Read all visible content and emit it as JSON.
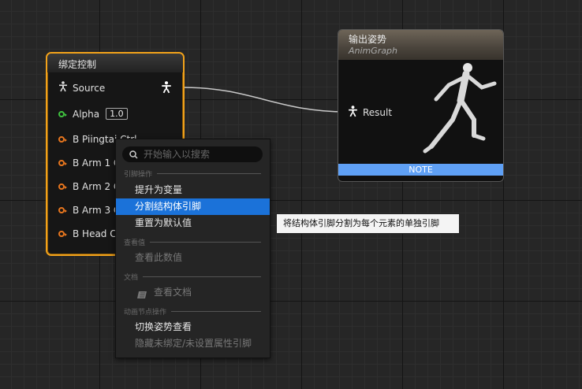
{
  "node_bind": {
    "title": "绑定控制",
    "source_label": "Source",
    "alpha_label": "Alpha",
    "alpha_value": "1.0",
    "pins": [
      "B Piingtai Ctrl",
      "B Arm 1 C",
      "B Arm 2 C",
      "B Arm 3 C",
      "B Head C"
    ]
  },
  "node_output": {
    "title": "输出姿势",
    "subtitle": "AnimGraph",
    "result_label": "Result",
    "note": "NOTE"
  },
  "context_menu": {
    "search_placeholder": "开始输入以搜索",
    "sections": [
      {
        "label": "引脚操作",
        "items": [
          {
            "label": "提升为变量",
            "enabled": true
          },
          {
            "label": "分割结构体引脚",
            "enabled": true,
            "selected": true
          },
          {
            "label": "重置为默认值",
            "enabled": true
          }
        ]
      },
      {
        "label": "查看值",
        "items": [
          {
            "label": "查看此数值",
            "enabled": false
          }
        ]
      },
      {
        "label": "文档",
        "items": [
          {
            "label": "查看文档",
            "enabled": false
          }
        ]
      },
      {
        "label": "动画节点操作",
        "items": [
          {
            "label": "切换姿势查看",
            "enabled": true
          },
          {
            "label": "隐藏未绑定/未设置属性引脚",
            "enabled": false
          }
        ]
      }
    ]
  },
  "tooltip": "将结构体引脚分割为每个元素的单独引脚",
  "colors": {
    "selected_node_border": "#f2a21a",
    "menu_selection": "#1b72d9",
    "note_bar": "#5fa0f5",
    "struct_pin": "#e8761e",
    "float_pin": "#3fc23f"
  }
}
